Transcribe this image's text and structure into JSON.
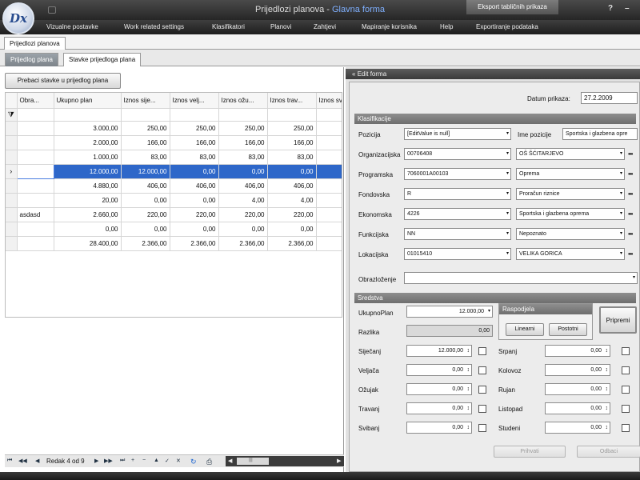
{
  "app": {
    "logo_text": "Dx",
    "window_title": "Prijedlozi planova - ",
    "window_title_highlight": "Glavna forma",
    "context_tab": "Eksport tabličnih prikaza",
    "help_glyph": "?",
    "minimize_glyph": "–"
  },
  "menu": [
    "Vizualne postavke",
    "Work related settings",
    "Klasifikatori",
    "Planovi",
    "Zahtjevi",
    "Mapiranje korisnika",
    "Help",
    "Exportiranje podataka"
  ],
  "doc_tab": "Prijedlozi planova",
  "sub_tabs": [
    "Prijedlog plana",
    "Stavke prijedloga plana"
  ],
  "left": {
    "transfer_button": "Prebaci stavke u prijedlog plana",
    "grid": {
      "columns": [
        "Obra...",
        "Ukupno plan",
        "Iznos sije...",
        "Iznos velj...",
        "Iznos ožu...",
        "Iznos trav...",
        "Iznos sv"
      ],
      "filter_glyph": "⧩",
      "rows": [
        {
          "ind": "",
          "c": [
            "",
            "3.000,00",
            "250,00",
            "250,00",
            "250,00",
            "250,00",
            "2"
          ]
        },
        {
          "ind": "",
          "c": [
            "",
            "2.000,00",
            "166,00",
            "166,00",
            "166,00",
            "166,00",
            "1"
          ]
        },
        {
          "ind": "",
          "c": [
            "",
            "1.000,00",
            "83,00",
            "83,00",
            "83,00",
            "83,00",
            ""
          ]
        },
        {
          "ind": "›",
          "c": [
            "",
            "12.000,00",
            "12.000,00",
            "0,00",
            "0,00",
            "0,00",
            ""
          ]
        },
        {
          "ind": "",
          "c": [
            "",
            "4.880,00",
            "406,00",
            "406,00",
            "406,00",
            "406,00",
            "4"
          ]
        },
        {
          "ind": "",
          "c": [
            "",
            "20,00",
            "0,00",
            "0,00",
            "4,00",
            "4,00",
            ""
          ]
        },
        {
          "ind": "",
          "c": [
            "asdasd",
            "2.660,00",
            "220,00",
            "220,00",
            "220,00",
            "220,00",
            "2"
          ]
        },
        {
          "ind": "",
          "c": [
            "",
            "0,00",
            "0,00",
            "0,00",
            "0,00",
            "0,00",
            ""
          ]
        },
        {
          "ind": "",
          "c": [
            "",
            "28.400,00",
            "2.366,00",
            "2.366,00",
            "2.366,00",
            "2.366,00",
            "2.3"
          ]
        }
      ]
    },
    "navigator": {
      "text": "Redak 4 od 9",
      "first": "⏮",
      "prev_page": "◀◀",
      "prev": "◀",
      "next": "▶",
      "next_page": "▶▶",
      "last": "⏭",
      "add": "+",
      "remove": "−",
      "edit": "▲",
      "save": "✓",
      "cancel": "✕",
      "refresh": "↻",
      "print": "⎙",
      "scroll_left": "◀",
      "scroll_right": "▶",
      "scroll_thumb": "|||"
    }
  },
  "edit_form": {
    "header_icon": "«",
    "header": "Edit forma",
    "datum_label": "Datum prikaza:",
    "datum_value": "27.2.2009",
    "klasifikacije_header": "Klasifikacije",
    "pozicija_label": "Pozicija",
    "pozicija_value": "[EditValue is null]",
    "ime_pozicije_label": "Ime pozicije",
    "ime_pozicije_value": "Sportska i glazbena opre",
    "class_rows": [
      {
        "label": "Organizacijska",
        "code": "00706408",
        "name": "OŠ ŠĆITARJEVO"
      },
      {
        "label": "Programska",
        "code": "7060001A00103",
        "name": "Oprema"
      },
      {
        "label": "Fondovska",
        "code": "R",
        "name": "Proračun riznice"
      },
      {
        "label": "Ekonomska",
        "code": "4226",
        "name": "Sportska i glazbena oprema"
      },
      {
        "label": "Funkcijska",
        "code": "NN",
        "name": "Nepoznato"
      },
      {
        "label": "Lokacijska",
        "code": "01015410",
        "name": "VELIKA GORICA"
      }
    ],
    "obrazlozenje_label": "Obrazloženje",
    "obrazlozenje_value": "",
    "sredstva_header": "Sredstva",
    "ukupno_label": "UkupnoPlan",
    "ukupno_value": "12.000,00",
    "razlika_label": "Razlika",
    "razlika_value": "0,00",
    "raspodjela_header": "Raspodjela",
    "linearni_button": "Linearni",
    "postotni_button": "Postotni",
    "pripremi_button": "Pripremi",
    "months_left": [
      {
        "label": "Siječanj",
        "value": "12.000,00"
      },
      {
        "label": "Veljača",
        "value": "0,00"
      },
      {
        "label": "Ožujak",
        "value": "0,00"
      },
      {
        "label": "Travanj",
        "value": "0,00"
      },
      {
        "label": "Svibanj",
        "value": "0,00"
      }
    ],
    "months_right": [
      {
        "label": "Srpanj",
        "value": "0,00"
      },
      {
        "label": "Kolovoz",
        "value": "0,00"
      },
      {
        "label": "Rujan",
        "value": "0,00"
      },
      {
        "label": "Listopad",
        "value": "0,00"
      },
      {
        "label": "Studeni",
        "value": "0,00"
      }
    ],
    "prihvati_button": "Prihvati",
    "odbaci_button": "Odbaci",
    "dropdown_glyph": "▾",
    "spin_glyph": "↕",
    "ellipsis_glyph": "•••"
  },
  "colors": {
    "selection": "#2e67c9",
    "title_highlight": "#7fb0ff"
  }
}
